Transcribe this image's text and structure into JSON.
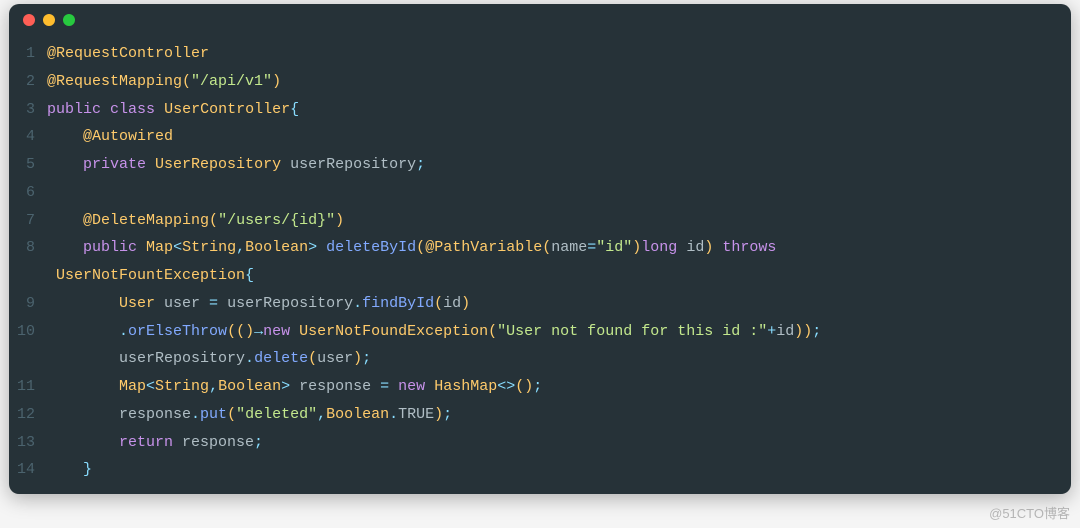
{
  "watermark": "@51CTO博客",
  "titlebar": {
    "dots": [
      "red",
      "yellow",
      "green"
    ]
  },
  "code": {
    "lines": [
      {
        "n": "1",
        "indent": "",
        "tokens": [
          {
            "c": "tok-annotation",
            "t": "@RequestController"
          }
        ]
      },
      {
        "n": "2",
        "indent": "",
        "tokens": [
          {
            "c": "tok-annotation",
            "t": "@RequestMapping"
          },
          {
            "c": "tok-paren",
            "t": "("
          },
          {
            "c": "tok-string",
            "t": "\"/api/v1\""
          },
          {
            "c": "tok-paren",
            "t": ")"
          }
        ]
      },
      {
        "n": "3",
        "indent": "",
        "tokens": [
          {
            "c": "tok-keyword",
            "t": "public"
          },
          {
            "c": "tok-ident",
            "t": " "
          },
          {
            "c": "tok-keyword",
            "t": "class"
          },
          {
            "c": "tok-ident",
            "t": " "
          },
          {
            "c": "tok-type",
            "t": "UserController"
          },
          {
            "c": "tok-punc",
            "t": "{"
          }
        ]
      },
      {
        "n": "4",
        "indent": "    ",
        "tokens": [
          {
            "c": "tok-annotation",
            "t": "@Autowired"
          }
        ]
      },
      {
        "n": "5",
        "indent": "    ",
        "tokens": [
          {
            "c": "tok-keyword",
            "t": "private"
          },
          {
            "c": "tok-ident",
            "t": " "
          },
          {
            "c": "tok-type",
            "t": "UserRepository"
          },
          {
            "c": "tok-ident",
            "t": " userRepository"
          },
          {
            "c": "tok-punc",
            "t": ";"
          }
        ]
      },
      {
        "n": "6",
        "indent": "",
        "tokens": []
      },
      {
        "n": "7",
        "indent": "    ",
        "tokens": [
          {
            "c": "tok-annotation",
            "t": "@DeleteMapping"
          },
          {
            "c": "tok-paren",
            "t": "("
          },
          {
            "c": "tok-string",
            "t": "\"/users/{id}\""
          },
          {
            "c": "tok-paren",
            "t": ")"
          }
        ]
      },
      {
        "n": "8",
        "indent": "    ",
        "tokens": [
          {
            "c": "tok-keyword",
            "t": "public"
          },
          {
            "c": "tok-ident",
            "t": " "
          },
          {
            "c": "tok-type",
            "t": "Map"
          },
          {
            "c": "tok-punc",
            "t": "<"
          },
          {
            "c": "tok-type",
            "t": "String"
          },
          {
            "c": "tok-punc",
            "t": ","
          },
          {
            "c": "tok-type",
            "t": "Boolean"
          },
          {
            "c": "tok-punc",
            "t": ">"
          },
          {
            "c": "tok-ident",
            "t": " "
          },
          {
            "c": "tok-method",
            "t": "deleteById"
          },
          {
            "c": "tok-paren",
            "t": "("
          },
          {
            "c": "tok-annotation",
            "t": "@PathVariable"
          },
          {
            "c": "tok-paren",
            "t": "("
          },
          {
            "c": "tok-ident",
            "t": "name"
          },
          {
            "c": "tok-punc",
            "t": "="
          },
          {
            "c": "tok-string",
            "t": "\"id\""
          },
          {
            "c": "tok-paren",
            "t": ")"
          },
          {
            "c": "tok-keyword",
            "t": "long"
          },
          {
            "c": "tok-ident",
            "t": " id"
          },
          {
            "c": "tok-paren",
            "t": ")"
          },
          {
            "c": "tok-ident",
            "t": " "
          },
          {
            "c": "tok-keyword",
            "t": "throws"
          }
        ]
      },
      {
        "n": "",
        "indent": " ",
        "tokens": [
          {
            "c": "tok-type",
            "t": "UserNotFountException"
          },
          {
            "c": "tok-punc",
            "t": "{"
          }
        ]
      },
      {
        "n": "9",
        "indent": "        ",
        "tokens": [
          {
            "c": "tok-type",
            "t": "User"
          },
          {
            "c": "tok-ident",
            "t": " user "
          },
          {
            "c": "tok-punc",
            "t": "="
          },
          {
            "c": "tok-ident",
            "t": " userRepository"
          },
          {
            "c": "tok-punc",
            "t": "."
          },
          {
            "c": "tok-method",
            "t": "findById"
          },
          {
            "c": "tok-paren",
            "t": "("
          },
          {
            "c": "tok-ident",
            "t": "id"
          },
          {
            "c": "tok-paren",
            "t": ")"
          }
        ]
      },
      {
        "n": "10",
        "indent": "        ",
        "tokens": [
          {
            "c": "tok-punc",
            "t": "."
          },
          {
            "c": "tok-method",
            "t": "orElseThrow"
          },
          {
            "c": "tok-paren",
            "t": "(()"
          },
          {
            "c": "tok-punc",
            "t": "→"
          },
          {
            "c": "tok-keyword",
            "t": "new"
          },
          {
            "c": "tok-ident",
            "t": " "
          },
          {
            "c": "tok-type",
            "t": "UserNotFoundException"
          },
          {
            "c": "tok-paren",
            "t": "("
          },
          {
            "c": "tok-string",
            "t": "\"User not found for this id :\""
          },
          {
            "c": "tok-punc",
            "t": "+"
          },
          {
            "c": "tok-ident",
            "t": "id"
          },
          {
            "c": "tok-paren",
            "t": "))"
          },
          {
            "c": "tok-punc",
            "t": ";"
          }
        ]
      },
      {
        "n": "",
        "indent": "        ",
        "tokens": [
          {
            "c": "tok-ident",
            "t": "userRepository"
          },
          {
            "c": "tok-punc",
            "t": "."
          },
          {
            "c": "tok-method",
            "t": "delete"
          },
          {
            "c": "tok-paren",
            "t": "("
          },
          {
            "c": "tok-ident",
            "t": "user"
          },
          {
            "c": "tok-paren",
            "t": ")"
          },
          {
            "c": "tok-punc",
            "t": ";"
          }
        ]
      },
      {
        "n": "11",
        "indent": "        ",
        "tokens": [
          {
            "c": "tok-type",
            "t": "Map"
          },
          {
            "c": "tok-punc",
            "t": "<"
          },
          {
            "c": "tok-type",
            "t": "String"
          },
          {
            "c": "tok-punc",
            "t": ","
          },
          {
            "c": "tok-type",
            "t": "Boolean"
          },
          {
            "c": "tok-punc",
            "t": ">"
          },
          {
            "c": "tok-ident",
            "t": " response "
          },
          {
            "c": "tok-punc",
            "t": "="
          },
          {
            "c": "tok-ident",
            "t": " "
          },
          {
            "c": "tok-keyword",
            "t": "new"
          },
          {
            "c": "tok-ident",
            "t": " "
          },
          {
            "c": "tok-type",
            "t": "HashMap"
          },
          {
            "c": "tok-punc",
            "t": "<>"
          },
          {
            "c": "tok-paren",
            "t": "()"
          },
          {
            "c": "tok-punc",
            "t": ";"
          }
        ]
      },
      {
        "n": "12",
        "indent": "        ",
        "tokens": [
          {
            "c": "tok-ident",
            "t": "response"
          },
          {
            "c": "tok-punc",
            "t": "."
          },
          {
            "c": "tok-method",
            "t": "put"
          },
          {
            "c": "tok-paren",
            "t": "("
          },
          {
            "c": "tok-string",
            "t": "\"deleted\""
          },
          {
            "c": "tok-punc",
            "t": ","
          },
          {
            "c": "tok-type",
            "t": "Boolean"
          },
          {
            "c": "tok-punc",
            "t": "."
          },
          {
            "c": "tok-const",
            "t": "TRUE"
          },
          {
            "c": "tok-paren",
            "t": ")"
          },
          {
            "c": "tok-punc",
            "t": ";"
          }
        ]
      },
      {
        "n": "13",
        "indent": "        ",
        "tokens": [
          {
            "c": "tok-keyword",
            "t": "return"
          },
          {
            "c": "tok-ident",
            "t": " response"
          },
          {
            "c": "tok-punc",
            "t": ";"
          }
        ]
      },
      {
        "n": "14",
        "indent": "    ",
        "tokens": [
          {
            "c": "tok-punc",
            "t": "}"
          }
        ]
      }
    ]
  }
}
